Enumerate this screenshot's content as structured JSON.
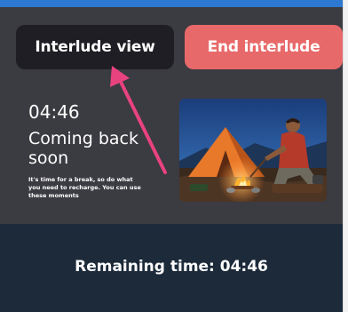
{
  "buttons": {
    "interlude_view": "Interlude view",
    "end_interlude": "End interlude"
  },
  "interlude": {
    "countdown": "04:46",
    "headline": "Coming back soon",
    "note": "It's time for a break, so do what you need to recharge. You can use these moments"
  },
  "footer": {
    "remaining_time": "Remaining time: 04:46"
  },
  "colors": {
    "accent_bar": "#2d78d2",
    "stage_bg": "#3b3b42",
    "interlude_button_bg": "#1e1e24",
    "end_button_bg": "#e8696a",
    "footer_bg": "#1c2a3a",
    "annotation_arrow": "#e8437e"
  },
  "image": {
    "subject": "man sitting by campfire in front of tent at dusk"
  }
}
